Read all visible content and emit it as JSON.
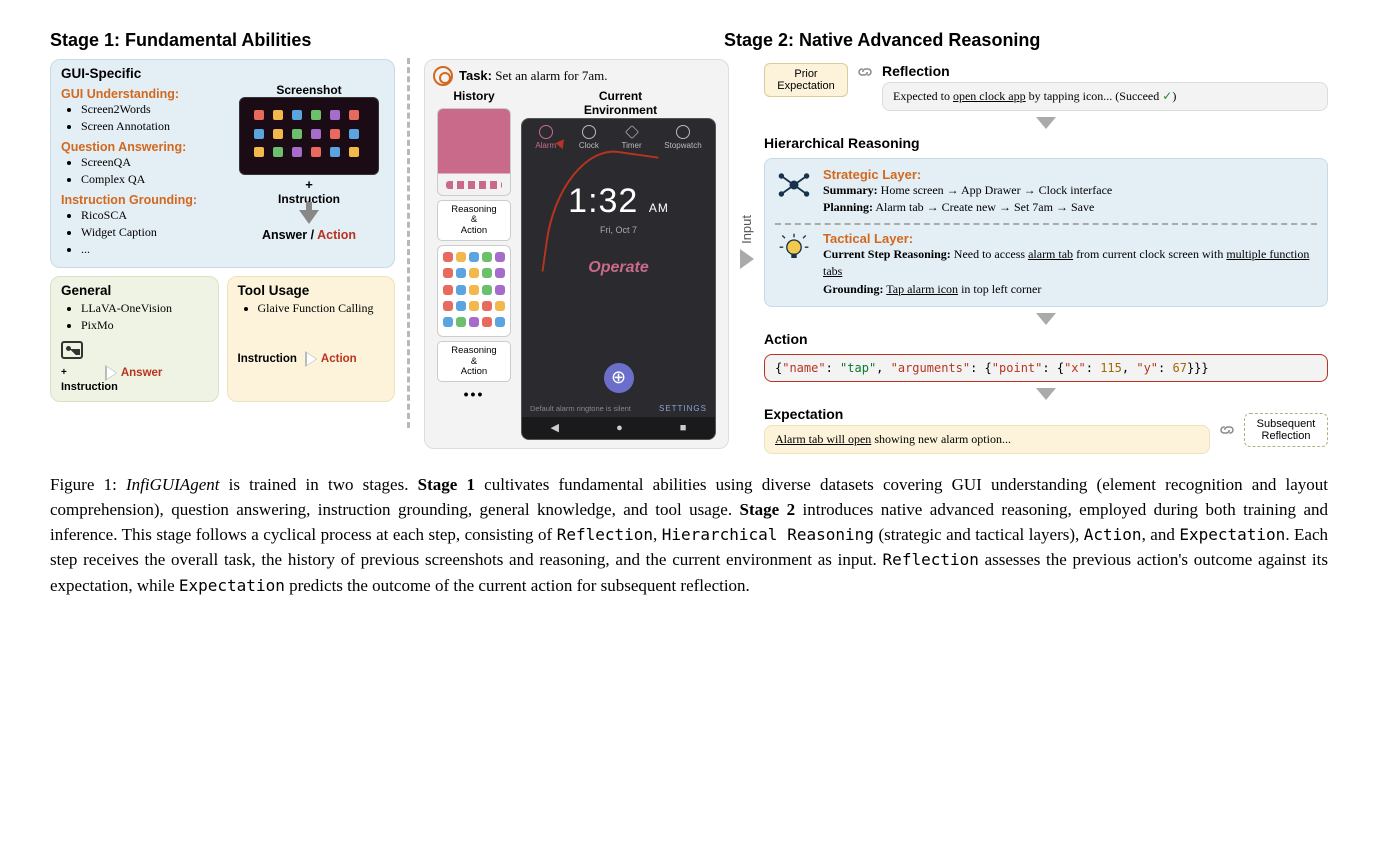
{
  "stage1": {
    "title": "Stage 1: Fundamental Abilities",
    "gui": {
      "heading": "GUI-Specific",
      "cat1": "GUI Understanding:",
      "cat1_items": [
        "Screen2Words",
        "Screen Annotation"
      ],
      "cat2": "Question Answering:",
      "cat2_items": [
        "ScreenQA",
        "Complex QA"
      ],
      "cat3": "Instruction Grounding:",
      "cat3_items": [
        "RicoSCA",
        "Widget Caption",
        "..."
      ],
      "ss_label": "Screenshot",
      "plus": "+",
      "instr": "Instruction",
      "answer": "Answer",
      "slash": " / ",
      "action": "Action"
    },
    "general": {
      "heading": "General",
      "items": [
        "LLaVA-OneVision",
        "PixMo"
      ],
      "plus": "+",
      "instr": "Instruction",
      "answer": "Answer"
    },
    "tool": {
      "heading": "Tool Usage",
      "items": [
        "Glaive Function Calling"
      ],
      "instr": "Instruction",
      "action": "Action"
    }
  },
  "stage2": {
    "title": "Stage 2: Native Advanced Reasoning",
    "task_label": "Task:",
    "task_text": " Set an alarm for 7am.",
    "history_label": "History",
    "env_label": "Current\nEnvironment",
    "ra_box": "Reasoning\n&\nAction",
    "dots": "•••",
    "clock": {
      "tabs": [
        "Alarm",
        "Clock",
        "Timer",
        "Stopwatch"
      ],
      "time": "1:32",
      "ampm": "AM",
      "sub": "Fri, Oct 7",
      "operate": "Operate",
      "ringtone": "Default alarm ringtone is silent",
      "settings": "SETTINGS"
    },
    "input_label": "Input",
    "pe": "Prior\nExpectation",
    "reflection": {
      "heading": "Reflection",
      "text_pre": "Expected to ",
      "text_ul": "open clock app",
      "text_post": " by tapping icon... (Succeed ",
      "text_close": ")"
    },
    "hr_heading": "Hierarchical Reasoning",
    "strategic": {
      "title": "Strategic Layer:",
      "summary_k": "Summary:",
      "summary_v": " Home screen → App Drawer → Clock interface",
      "planning_k": "Planning:",
      "planning_v": " Alarm tab → Create new → Set 7am → Save"
    },
    "tactical": {
      "title": "Tactical Layer:",
      "csr_k": "Current Step Reasoning:",
      "csr_pre": " Need to access ",
      "csr_ul1": "alarm tab",
      "csr_mid": " from current clock screen with ",
      "csr_ul2": "multiple function tabs",
      "grd_k": "Grounding:",
      "grd_ul": "Tap alarm icon",
      "grd_post": " in top left corner"
    },
    "action_heading": "Action",
    "action_json": {
      "open": "{",
      "name_k": "\"name\"",
      "name_v": "\"tap\"",
      "args_k": "\"arguments\"",
      "point_k": "\"point\"",
      "x_k": "\"x\"",
      "x_v": "115",
      "y_k": "\"y\"",
      "y_v": "67",
      "close": "}}}"
    },
    "expect_heading": "Expectation",
    "expect_ul": "Alarm tab will open",
    "expect_post": " showing new alarm option...",
    "sr": "Subsequent\nReflection"
  },
  "caption": {
    "fig": "Figure 1: ",
    "agent": "InfiGUIAgent",
    "p1": " is trained in two stages. ",
    "s1": "Stage 1",
    "p2": " cultivates fundamental abilities using diverse datasets covering GUI understanding (element recognition and layout comprehension), question answering, instruction grounding, general knowledge, and tool usage. ",
    "s2": "Stage 2",
    "p3": " introduces native advanced reasoning, employed during both training and inference. This stage follows a cyclical process at each step, consisting of ",
    "m1": "Reflection",
    "p4": ", ",
    "m2": "Hierarchical Reasoning",
    "p5": " (strategic and tactical layers), ",
    "m3": "Action",
    "p6": ", and ",
    "m4": "Expectation",
    "p7": ". Each step receives the overall task, the history of previous screenshots and reasoning, and the current environment as input. ",
    "m5": "Reflection",
    "p8": " assesses the previous action's outcome against its expectation, while ",
    "m6": "Expectation",
    "p9": " predicts the outcome of the current action for subsequent reflection."
  },
  "colors": {
    "app_dots": [
      "#e86a5e",
      "#f2b84b",
      "#5aa4e0",
      "#6cc06c",
      "#a66ccc",
      "#e86a5e",
      "#5aa4e0",
      "#f2b84b",
      "#6cc06c",
      "#a66ccc",
      "#e86a5e",
      "#5aa4e0",
      "#f2b84b",
      "#6cc06c",
      "#a66ccc",
      "#e86a5e",
      "#5aa4e0",
      "#f2b84b"
    ]
  }
}
